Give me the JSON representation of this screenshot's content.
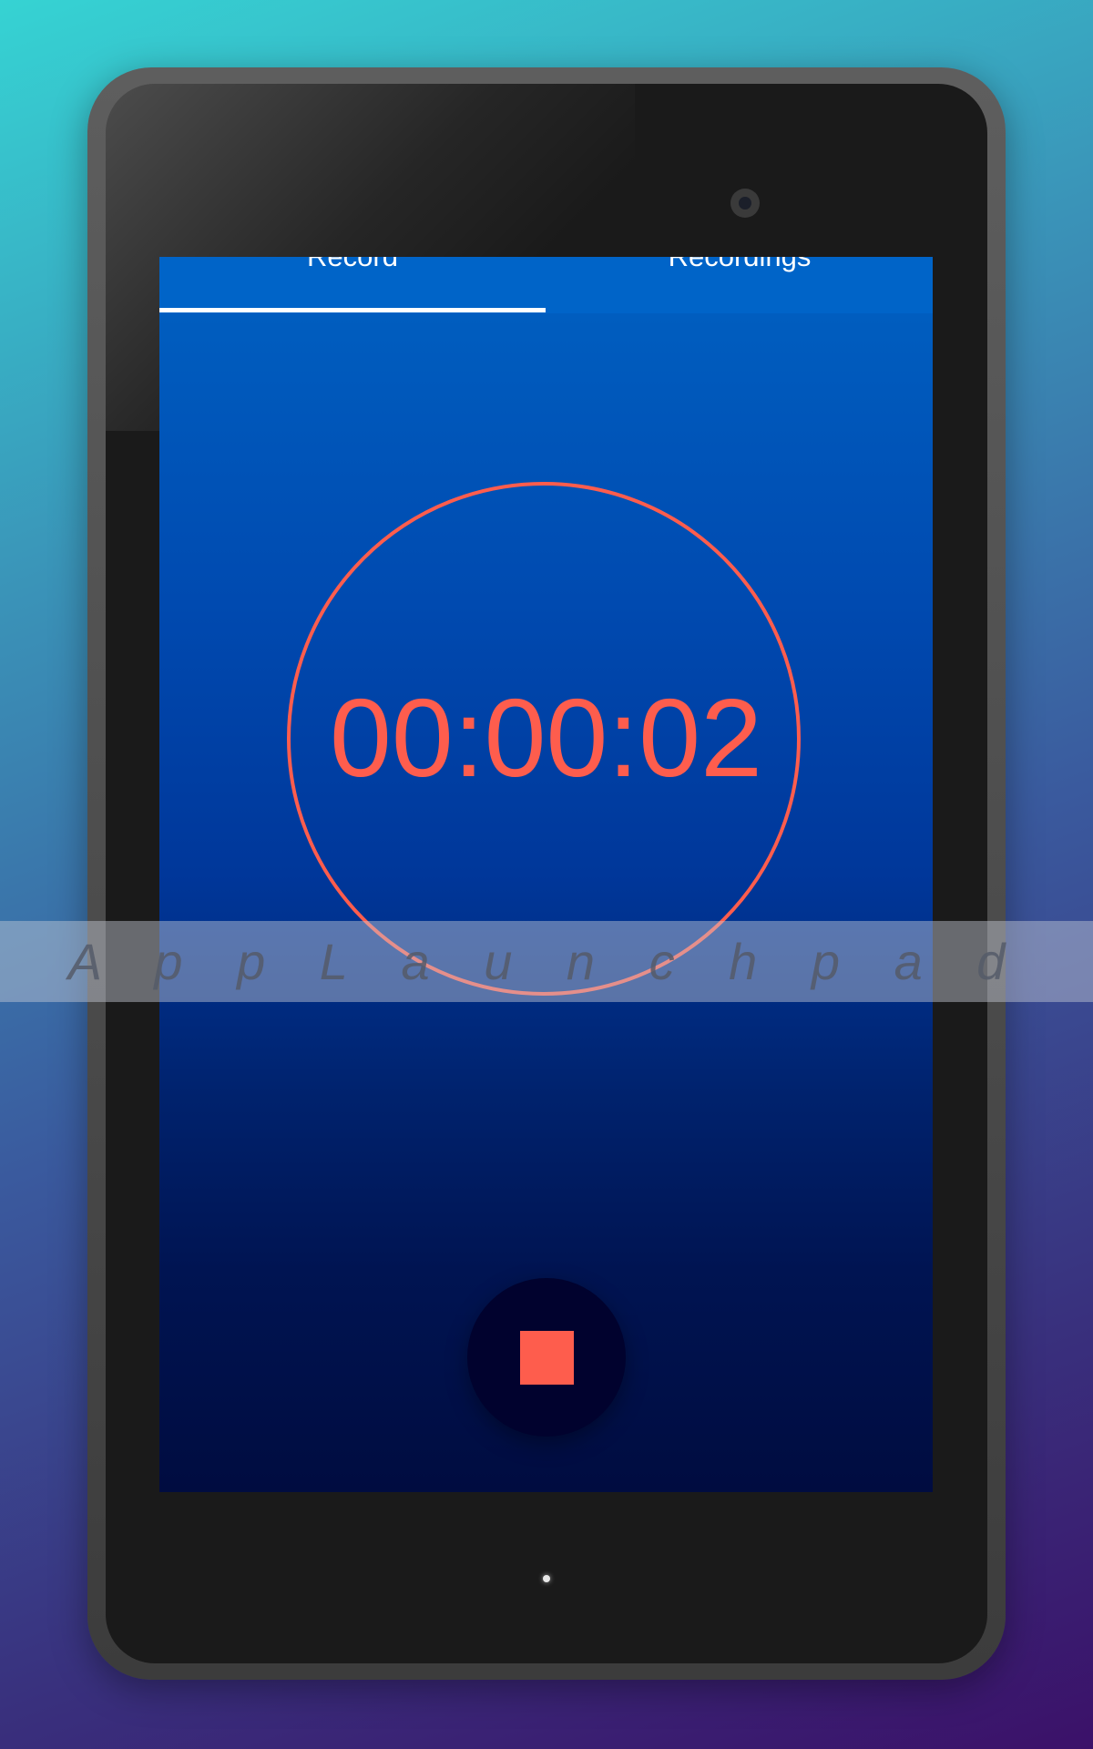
{
  "tabs": [
    {
      "label": "Record",
      "selected": true
    },
    {
      "label": "Recordings",
      "selected": false
    }
  ],
  "timer": {
    "display": "00:00:02"
  },
  "controls": {
    "primary_action": "stop-icon"
  },
  "watermark": {
    "text": "A p p L a u n c h p a d"
  },
  "colors": {
    "accent": "#fe5d4d",
    "tabbar": "#0064c8",
    "button_bg": "#01022e"
  }
}
